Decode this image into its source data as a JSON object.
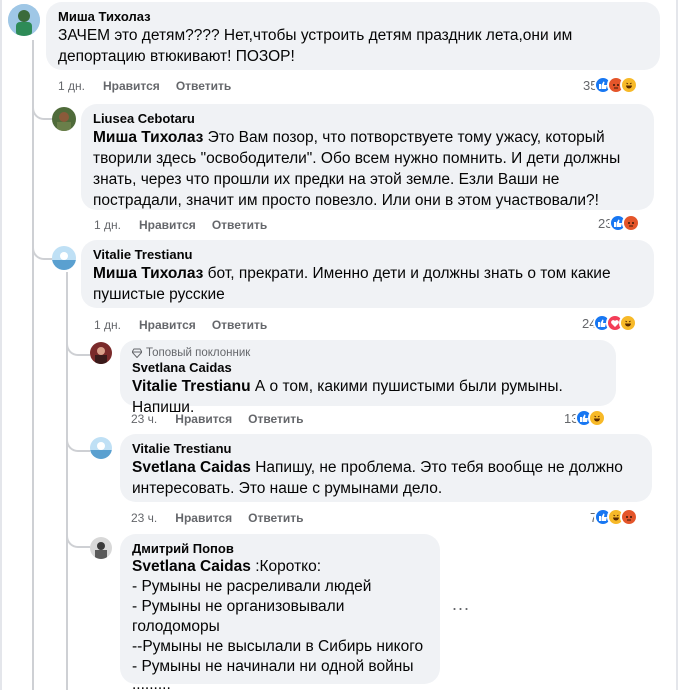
{
  "comments": [
    {
      "author": "Миша Тихолаз",
      "mention": "",
      "text": "ЗАЧЕМ это детям???? Нет,чтобы устроить детям праздник лета,они им депортацию втюкивают! ПОЗОР!",
      "time": "1 дн.",
      "like_label": "Нравится",
      "reply_label": "Ответить",
      "reaction_count": "35",
      "reactions": [
        "like-reaction-icon",
        "angry-reaction-icon",
        "haha-reaction-icon"
      ]
    },
    {
      "author": "Liusea Cebotaru",
      "mention": "Миша Тихолаз",
      "text": " Это Вам позор, что потворствуете тому ужасу, который творили здесь \"освободители\". Обо всем нужно помнить. И дети должны знать, через что прошли их предки на этой земле. Езли Ваши не пострадали, значит им просто повезло. Или они в этом участвовали?!",
      "time": "1 дн.",
      "like_label": "Нравится",
      "reply_label": "Ответить",
      "reaction_count": "23",
      "reactions": [
        "like-reaction-icon",
        "angry-reaction-icon"
      ]
    },
    {
      "author": "Vitalie Trestianu",
      "mention": "Миша Тихолаз",
      "text": " бот, прекрати. Именно дети и должны знать о том какие пушистые русские",
      "time": "1 дн.",
      "like_label": "Нравится",
      "reply_label": "Ответить",
      "reaction_count": "24",
      "reactions": [
        "like-reaction-icon",
        "love-reaction-icon",
        "haha-reaction-icon"
      ]
    },
    {
      "badge": "Топовый поклонник",
      "author": "Svetlana Caidas",
      "mention": "Vitalie Trestianu",
      "text": " А о том, какими пушистыми были румыны. Напиши.",
      "time": "23 ч.",
      "like_label": "Нравится",
      "reply_label": "Ответить",
      "reaction_count": "13",
      "reactions": [
        "like-reaction-icon",
        "haha-reaction-icon"
      ]
    },
    {
      "author": "Vitalie Trestianu",
      "mention": "Svetlana Caidas",
      "text": " Напишу, не проблема. Это тебя вообще не должно интересовать. Это наше с румынами дело.",
      "time": "23 ч.",
      "like_label": "Нравится",
      "reply_label": "Ответить",
      "reaction_count": "7",
      "reactions": [
        "like-reaction-icon",
        "haha-reaction-icon",
        "angry-reaction-icon"
      ]
    },
    {
      "author": "Дмитрий Попов",
      "mention": "Svetlana Caidas",
      "text": " :Коротко:",
      "lines": [
        "- Румыны не расреливали людей",
        "- Румыны не организовывали голодоморы",
        "--Румыны не высылали в Сибирь никого",
        "- Румыны не начинали ни одной войны",
        "........."
      ],
      "more_label": "..."
    }
  ],
  "colors": {
    "bubble": "#f0f2f5",
    "meta": "#65676b",
    "like": "#1877f2",
    "angry": "#e4552a",
    "haha": "#f7b928",
    "love": "#f33e58"
  }
}
